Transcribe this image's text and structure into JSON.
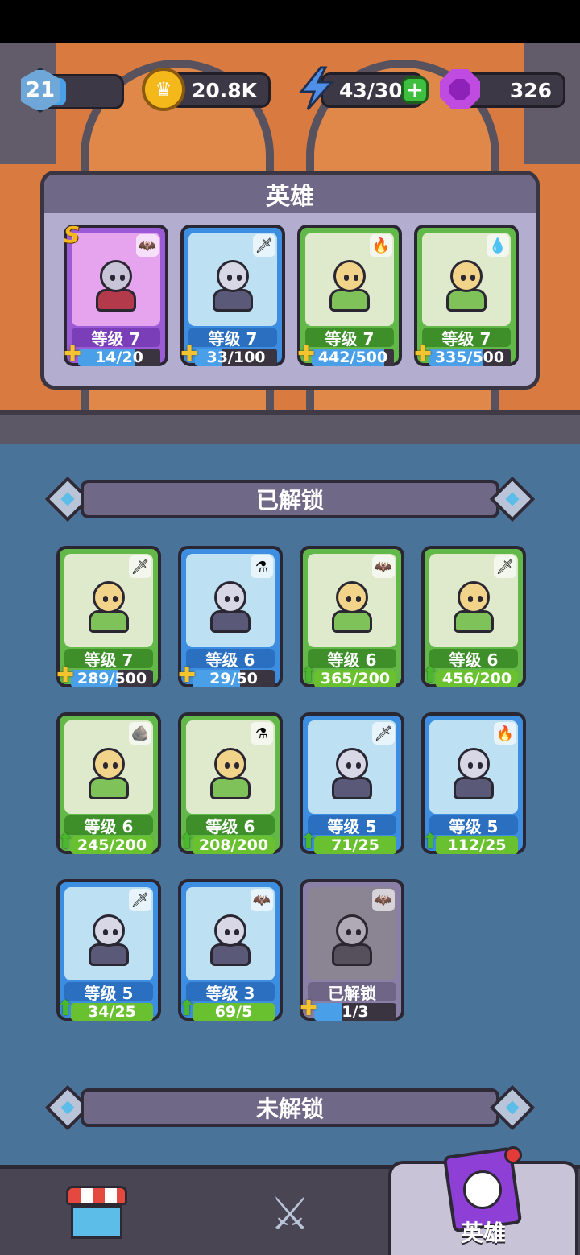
{
  "header": {
    "player_level": "21",
    "player_xp_fraction": 0.3,
    "gold": "20.8K",
    "energy": "43/30",
    "gems": "326"
  },
  "hero_panel": {
    "title": "英雄",
    "heroes": [
      {
        "rarity": "purple",
        "rank": "S",
        "type_icon": "bat-icon",
        "level": "等级 7",
        "progress": "14/20",
        "fraction": 0.7,
        "marker": "puzzle"
      },
      {
        "rarity": "blue",
        "rank": "",
        "type_icon": "sword-icon",
        "level": "等级 7",
        "progress": "33/100",
        "fraction": 0.33,
        "marker": "puzzle"
      },
      {
        "rarity": "green",
        "rank": "",
        "type_icon": "fire-icon",
        "level": "等级 7",
        "progress": "442/500",
        "fraction": 0.88,
        "marker": "puzzle"
      },
      {
        "rarity": "green",
        "rank": "",
        "type_icon": "water-drop-icon",
        "level": "等级 7",
        "progress": "335/500",
        "fraction": 0.67,
        "marker": "puzzle"
      }
    ]
  },
  "unlocked_section": {
    "title": "已解锁",
    "cards": [
      {
        "rarity": "green",
        "type_icon": "sword-icon",
        "level": "等级 7",
        "progress": "289/500",
        "fraction": 0.58,
        "marker": "puzzle"
      },
      {
        "rarity": "blue",
        "type_icon": "potion-icon",
        "level": "等级 6",
        "progress": "29/50",
        "fraction": 0.58,
        "marker": "puzzle"
      },
      {
        "rarity": "green",
        "type_icon": "bat-icon",
        "level": "等级 6",
        "progress": "365/200",
        "fraction": 1,
        "marker": "arrow"
      },
      {
        "rarity": "green",
        "type_icon": "sword-icon",
        "level": "等级 6",
        "progress": "456/200",
        "fraction": 1,
        "marker": "arrow"
      },
      {
        "rarity": "green",
        "type_icon": "rock-icon",
        "level": "等级 6",
        "progress": "245/200",
        "fraction": 1,
        "marker": "arrow"
      },
      {
        "rarity": "green",
        "type_icon": "potion-icon",
        "level": "等级 6",
        "progress": "208/200",
        "fraction": 1,
        "marker": "arrow"
      },
      {
        "rarity": "blue",
        "type_icon": "sword-icon",
        "level": "等级 5",
        "progress": "71/25",
        "fraction": 1,
        "marker": "arrow"
      },
      {
        "rarity": "blue",
        "type_icon": "fire-icon",
        "level": "等级 5",
        "progress": "112/25",
        "fraction": 1,
        "marker": "arrow"
      },
      {
        "rarity": "blue",
        "type_icon": "sword-icon",
        "level": "等级 5",
        "progress": "34/25",
        "fraction": 1,
        "marker": "arrow"
      },
      {
        "rarity": "blue",
        "type_icon": "bat-icon",
        "level": "等级 3",
        "progress": "69/5",
        "fraction": 1,
        "marker": "arrow"
      },
      {
        "rarity": "gray",
        "type_icon": "bat-icon",
        "level": "已解锁",
        "progress": "1/3",
        "fraction": 0.33,
        "marker": "puzzle"
      }
    ]
  },
  "locked_section": {
    "title": "未解锁"
  },
  "bottom_nav": {
    "tabs": [
      {
        "id": "shop",
        "label": ""
      },
      {
        "id": "battle",
        "label": ""
      },
      {
        "id": "heroes",
        "label": "英雄",
        "active": true
      }
    ]
  },
  "colors": {
    "green_card": "#63b84a",
    "blue_card": "#3d8ee0",
    "purple_card": "#9b5ad6",
    "panel_title": "#6f6887",
    "background_blue": "#4a7399"
  }
}
